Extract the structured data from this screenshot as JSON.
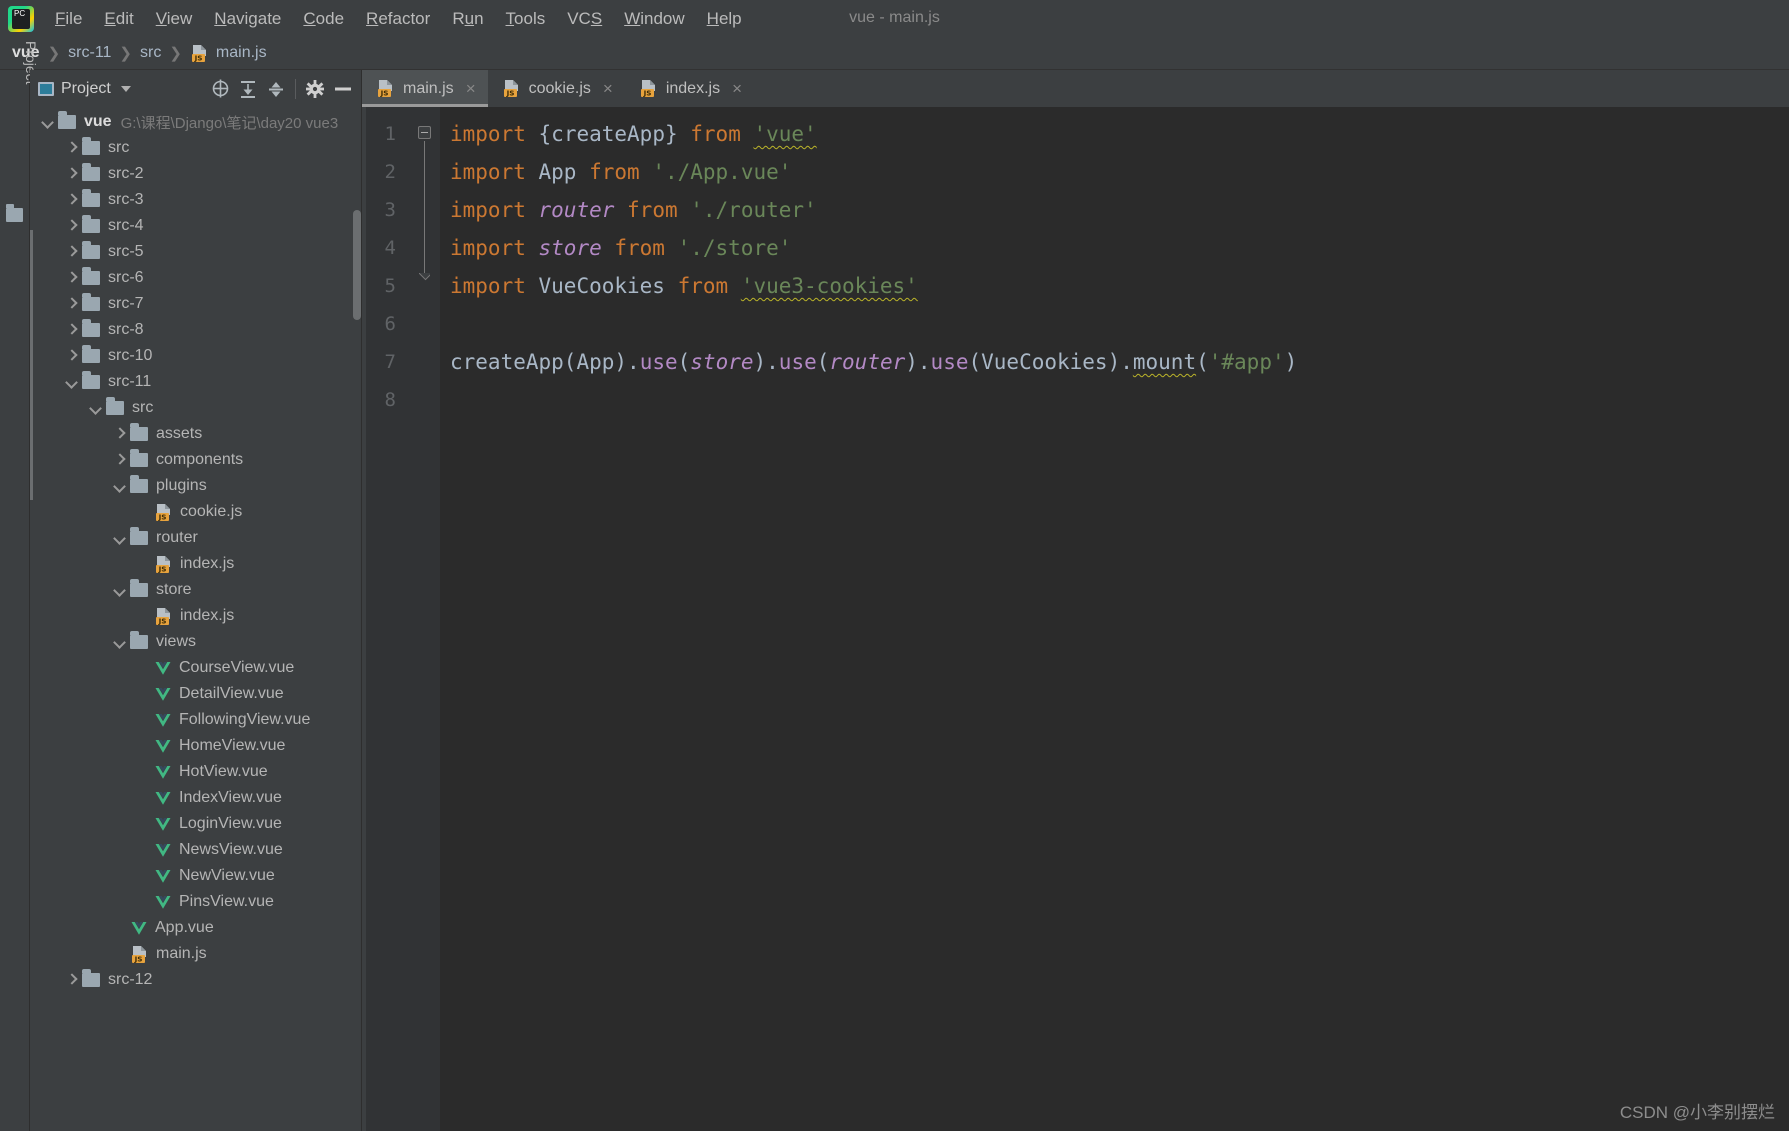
{
  "window": {
    "title": "vue - main.js"
  },
  "app": {
    "logo_text": "PC"
  },
  "menubar": [
    {
      "label": "File",
      "accel": "F"
    },
    {
      "label": "Edit",
      "accel": "E"
    },
    {
      "label": "View",
      "accel": "V"
    },
    {
      "label": "Navigate",
      "accel": "N"
    },
    {
      "label": "Code",
      "accel": "C"
    },
    {
      "label": "Refactor",
      "accel": "R"
    },
    {
      "label": "Run",
      "accel": "u"
    },
    {
      "label": "Tools",
      "accel": "T"
    },
    {
      "label": "VCS",
      "accel": "S"
    },
    {
      "label": "Window",
      "accel": "W"
    },
    {
      "label": "Help",
      "accel": "H"
    }
  ],
  "breadcrumb": {
    "segments": [
      "vue",
      "src-11",
      "src",
      "main.js"
    ],
    "separator": "❯",
    "file_icon": "js-file-icon"
  },
  "toolwindow_strip": {
    "label": "Project"
  },
  "project_panel": {
    "title": "Project",
    "icons": [
      "locate-icon",
      "expand-all-icon",
      "collapse-all-icon",
      "settings-gear-icon",
      "hide-icon"
    ],
    "tree": [
      {
        "depth": 0,
        "label": "vue",
        "kind": "folder",
        "state": "open",
        "bold": true,
        "path": "G:\\课程\\Django\\笔记\\day20 vue3"
      },
      {
        "depth": 1,
        "label": "src",
        "kind": "folder",
        "state": "closed"
      },
      {
        "depth": 1,
        "label": "src-2",
        "kind": "folder",
        "state": "closed"
      },
      {
        "depth": 1,
        "label": "src-3",
        "kind": "folder",
        "state": "closed"
      },
      {
        "depth": 1,
        "label": "src-4",
        "kind": "folder",
        "state": "closed"
      },
      {
        "depth": 1,
        "label": "src-5",
        "kind": "folder",
        "state": "closed"
      },
      {
        "depth": 1,
        "label": "src-6",
        "kind": "folder",
        "state": "closed"
      },
      {
        "depth": 1,
        "label": "src-7",
        "kind": "folder",
        "state": "closed"
      },
      {
        "depth": 1,
        "label": "src-8",
        "kind": "folder",
        "state": "closed"
      },
      {
        "depth": 1,
        "label": "src-10",
        "kind": "folder",
        "state": "closed"
      },
      {
        "depth": 1,
        "label": "src-11",
        "kind": "folder",
        "state": "open"
      },
      {
        "depth": 2,
        "label": "src",
        "kind": "folder",
        "state": "open"
      },
      {
        "depth": 3,
        "label": "assets",
        "kind": "folder",
        "state": "closed"
      },
      {
        "depth": 3,
        "label": "components",
        "kind": "folder",
        "state": "closed"
      },
      {
        "depth": 3,
        "label": "plugins",
        "kind": "folder",
        "state": "open"
      },
      {
        "depth": 4,
        "label": "cookie.js",
        "kind": "js"
      },
      {
        "depth": 3,
        "label": "router",
        "kind": "folder",
        "state": "open"
      },
      {
        "depth": 4,
        "label": "index.js",
        "kind": "js"
      },
      {
        "depth": 3,
        "label": "store",
        "kind": "folder",
        "state": "open"
      },
      {
        "depth": 4,
        "label": "index.js",
        "kind": "js"
      },
      {
        "depth": 3,
        "label": "views",
        "kind": "folder",
        "state": "open"
      },
      {
        "depth": 4,
        "label": "CourseView.vue",
        "kind": "vue"
      },
      {
        "depth": 4,
        "label": "DetailView.vue",
        "kind": "vue"
      },
      {
        "depth": 4,
        "label": "FollowingView.vue",
        "kind": "vue"
      },
      {
        "depth": 4,
        "label": "HomeView.vue",
        "kind": "vue"
      },
      {
        "depth": 4,
        "label": "HotView.vue",
        "kind": "vue"
      },
      {
        "depth": 4,
        "label": "IndexView.vue",
        "kind": "vue"
      },
      {
        "depth": 4,
        "label": "LoginView.vue",
        "kind": "vue"
      },
      {
        "depth": 4,
        "label": "NewsView.vue",
        "kind": "vue"
      },
      {
        "depth": 4,
        "label": "NewView.vue",
        "kind": "vue"
      },
      {
        "depth": 4,
        "label": "PinsView.vue",
        "kind": "vue"
      },
      {
        "depth": 3,
        "label": "App.vue",
        "kind": "vue"
      },
      {
        "depth": 3,
        "label": "main.js",
        "kind": "js"
      },
      {
        "depth": 1,
        "label": "src-12",
        "kind": "folder",
        "state": "closed"
      }
    ]
  },
  "editor": {
    "tabs": [
      {
        "label": "main.js",
        "icon": "js-file-icon",
        "active": true,
        "close": "×"
      },
      {
        "label": "cookie.js",
        "icon": "js-file-icon",
        "active": false,
        "close": "×"
      },
      {
        "label": "index.js",
        "icon": "js-file-icon",
        "active": false,
        "close": "×"
      }
    ],
    "line_numbers": [
      "1",
      "2",
      "3",
      "4",
      "5",
      "6",
      "7",
      "8"
    ],
    "lines": [
      {
        "n": 1,
        "tokens": [
          {
            "t": "import ",
            "c": "kw"
          },
          {
            "t": "{",
            "c": "brace"
          },
          {
            "t": "createApp",
            "c": "cls"
          },
          {
            "t": "} ",
            "c": "brace"
          },
          {
            "t": "from ",
            "c": "kw"
          },
          {
            "t": "'vue'",
            "c": "str squiggle"
          }
        ]
      },
      {
        "n": 2,
        "tokens": [
          {
            "t": "import ",
            "c": "kw"
          },
          {
            "t": "App ",
            "c": "cls"
          },
          {
            "t": "from ",
            "c": "kw"
          },
          {
            "t": "'./App.vue'",
            "c": "str"
          }
        ]
      },
      {
        "n": 3,
        "tokens": [
          {
            "t": "import ",
            "c": "kw"
          },
          {
            "t": "router ",
            "c": "ital"
          },
          {
            "t": "from ",
            "c": "kw"
          },
          {
            "t": "'./router'",
            "c": "str"
          }
        ]
      },
      {
        "n": 4,
        "tokens": [
          {
            "t": "import ",
            "c": "kw"
          },
          {
            "t": "store ",
            "c": "ital"
          },
          {
            "t": "from ",
            "c": "kw"
          },
          {
            "t": "'./store'",
            "c": "str"
          }
        ]
      },
      {
        "n": 5,
        "tokens": [
          {
            "t": "import ",
            "c": "kw"
          },
          {
            "t": "VueCookies ",
            "c": "cls"
          },
          {
            "t": "from ",
            "c": "kw"
          },
          {
            "t": "'vue3-cookies'",
            "c": "str squiggle"
          }
        ]
      },
      {
        "n": 6,
        "tokens": []
      },
      {
        "n": 7,
        "tokens": [
          {
            "t": "createApp",
            "c": "def"
          },
          {
            "t": "(",
            "c": "brace"
          },
          {
            "t": "App",
            "c": "cls"
          },
          {
            "t": ").",
            "c": "brace"
          },
          {
            "t": "use",
            "c": "meth"
          },
          {
            "t": "(",
            "c": "brace"
          },
          {
            "t": "store",
            "c": "ital"
          },
          {
            "t": ").",
            "c": "brace"
          },
          {
            "t": "use",
            "c": "meth"
          },
          {
            "t": "(",
            "c": "brace"
          },
          {
            "t": "router",
            "c": "ital"
          },
          {
            "t": ").",
            "c": "brace"
          },
          {
            "t": "use",
            "c": "meth"
          },
          {
            "t": "(",
            "c": "brace"
          },
          {
            "t": "VueCookies",
            "c": "cls"
          },
          {
            "t": ").",
            "c": "brace"
          },
          {
            "t": "mount",
            "c": "def squiggle"
          },
          {
            "t": "(",
            "c": "brace"
          },
          {
            "t": "'#app'",
            "c": "str"
          },
          {
            "t": ")",
            "c": "brace"
          }
        ]
      },
      {
        "n": 8,
        "tokens": []
      }
    ],
    "folds": [
      {
        "line": 1,
        "type": "collapse-top"
      },
      {
        "line": 5,
        "type": "collapse-bottom"
      }
    ]
  },
  "watermark": {
    "text": "CSDN @小李别摆烂"
  },
  "colors": {
    "chrome_bg": "#3c3f41",
    "editor_bg": "#2b2b2b",
    "gutter_bg": "#313335",
    "tab_active_bg": "#4e5254",
    "keyword": "#cc7832",
    "string": "#6a8759",
    "identifier": "#a9b7c6",
    "italic_global": "#b389c5",
    "squiggle": "#bbb529",
    "js_badge": "#e8a33d",
    "vue_green": "#41b883",
    "folder": "#9aa7b0"
  }
}
